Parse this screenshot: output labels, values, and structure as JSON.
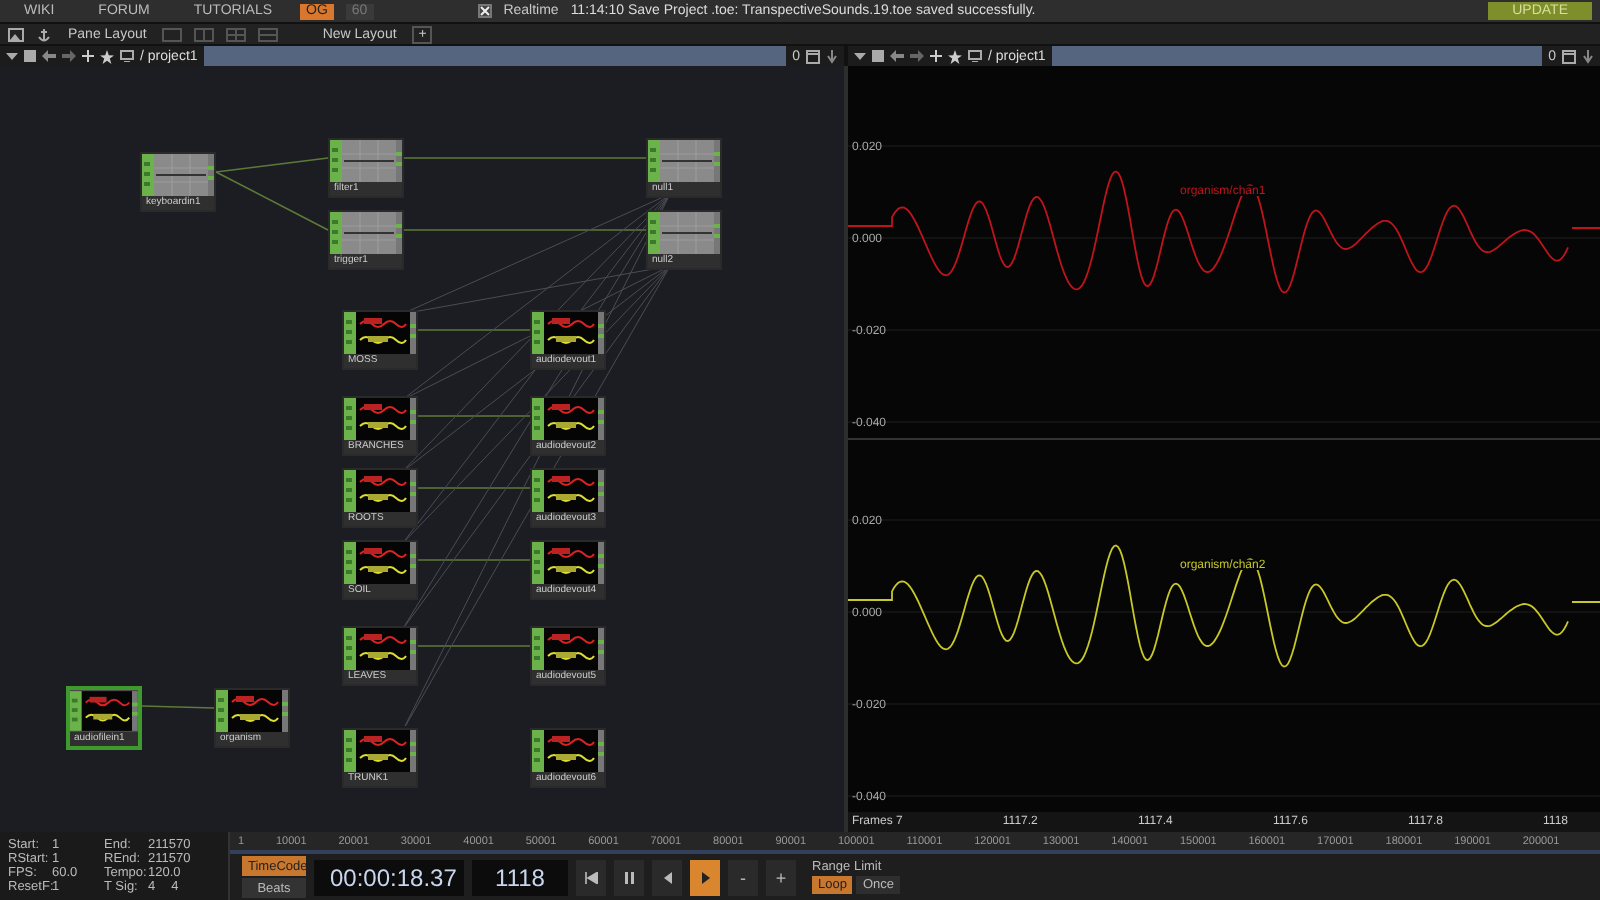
{
  "menu": [
    {
      "label": "WIKI"
    },
    {
      "label": "FORUM"
    },
    {
      "label": "TUTORIALS"
    }
  ],
  "rate_badges": [
    {
      "label": "OG",
      "selected": true
    },
    {
      "label": "60",
      "selected": false
    }
  ],
  "realtime": {
    "label": "Realtime",
    "checked": true
  },
  "status_message": "11:14:10 Save Project .toe: TranspectiveSounds.19.toe saved successfully.",
  "update_button": "UPDATE",
  "layout_bar": {
    "pane_layout": "Pane Layout",
    "new_layout": "New Layout",
    "add": "+"
  },
  "panes": [
    {
      "path": "/ project1",
      "zoom": "0"
    },
    {
      "path": "/ project1",
      "zoom": "0"
    }
  ],
  "network": {
    "nodes": [
      {
        "label": "keyboardin1",
        "kind": "chop",
        "selected": false
      },
      {
        "label": "filter1",
        "kind": "chop",
        "selected": false
      },
      {
        "label": "trigger1",
        "kind": "chop",
        "selected": false
      },
      {
        "label": "null1",
        "kind": "chop",
        "selected": false
      },
      {
        "label": "null2",
        "kind": "chop",
        "selected": false
      },
      {
        "label": "MOSS",
        "kind": "viewer",
        "selected": false
      },
      {
        "label": "audiodevout1",
        "kind": "viewer",
        "selected": false
      },
      {
        "label": "BRANCHES",
        "kind": "viewer",
        "selected": false
      },
      {
        "label": "audiodevout2",
        "kind": "viewer",
        "selected": false
      },
      {
        "label": "ROOTS",
        "kind": "viewer",
        "selected": false
      },
      {
        "label": "audiodevout3",
        "kind": "viewer",
        "selected": false
      },
      {
        "label": "SOIL",
        "kind": "viewer",
        "selected": false
      },
      {
        "label": "audiodevout4",
        "kind": "viewer",
        "selected": false
      },
      {
        "label": "LEAVES",
        "kind": "viewer",
        "selected": false
      },
      {
        "label": "audiodevout5",
        "kind": "viewer",
        "selected": false
      },
      {
        "label": "audiofilein1",
        "kind": "viewer",
        "selected": true
      },
      {
        "label": "organism",
        "kind": "viewer",
        "selected": false
      },
      {
        "label": "TRUNK1",
        "kind": "viewer",
        "selected": false
      },
      {
        "label": "audiodevout6",
        "kind": "viewer",
        "selected": false
      }
    ]
  },
  "channel_viewer": {
    "channels": [
      {
        "name": "organism/chan1",
        "color": "#c0141c",
        "yticks": [
          "0.020",
          "0.000",
          "-0.020",
          "-0.040"
        ]
      },
      {
        "name": "organism/chan2",
        "color": "#c8c828",
        "yticks": [
          "0.020",
          "0.000",
          "-0.020",
          "-0.040"
        ]
      }
    ],
    "x_axis": {
      "unit": "Frames 7",
      "ticks": [
        "1117.2",
        "1117.4",
        "1117.6",
        "1117.8",
        "1118"
      ]
    }
  },
  "stats": [
    {
      "label": "Start:",
      "value": "1"
    },
    {
      "label": "End:",
      "value": "211570"
    },
    {
      "label": "RStart:",
      "value": "1"
    },
    {
      "label": "REnd:",
      "value": "211570"
    },
    {
      "label": "FPS:",
      "value": "60.0"
    },
    {
      "label": "Tempo:",
      "value": "120.0"
    },
    {
      "label": "ResetF:",
      "value": "1"
    },
    {
      "label": "T Sig:",
      "value": "4",
      "value_2": "4"
    }
  ],
  "ruler": [
    "1",
    "10001",
    "20001",
    "30001",
    "40001",
    "50001",
    "60001",
    "70001",
    "80001",
    "90001",
    "100001",
    "110001",
    "120001",
    "130001",
    "140001",
    "150001",
    "160001",
    "170001",
    "180001",
    "190001",
    "200001"
  ],
  "time_modes": [
    {
      "label": "TimeCode",
      "selected": true
    },
    {
      "label": "Beats",
      "selected": false
    }
  ],
  "timecode": "00:00:18.37",
  "frame": "1118",
  "transport": [
    {
      "kind": "rewind",
      "selected": false
    },
    {
      "kind": "pause",
      "selected": false
    },
    {
      "kind": "back",
      "selected": false
    },
    {
      "kind": "play",
      "selected": true
    },
    {
      "kind": "minus",
      "label": "-",
      "selected": false
    },
    {
      "kind": "plus",
      "label": "+",
      "selected": false
    }
  ],
  "range_limit": {
    "label": "Range Limit",
    "options": [
      {
        "label": "Loop",
        "selected": true
      },
      {
        "label": "Once",
        "selected": false
      }
    ]
  }
}
